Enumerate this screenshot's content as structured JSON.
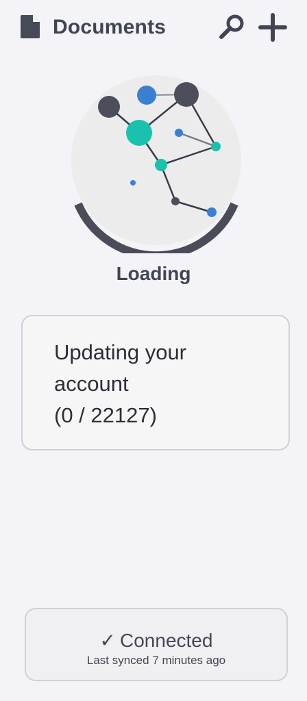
{
  "app_bar": {
    "title": "Documents",
    "icons": {
      "document": "document-icon",
      "search": "search-icon",
      "add": "plus-icon"
    }
  },
  "loading": {
    "label": "Loading"
  },
  "status_card": {
    "lines": [
      "Updating your",
      "account",
      "(0 / 22127)"
    ]
  },
  "sync_card": {
    "check": "✓",
    "status": "Connected",
    "subtitle": "Last synced 7 minutes ago"
  },
  "colors": {
    "background": "#f4f3f8",
    "text_dark": "#414553",
    "teal": "#18c2ac",
    "blue": "#3b7fd4",
    "node_dark": "#4c4e5c"
  }
}
